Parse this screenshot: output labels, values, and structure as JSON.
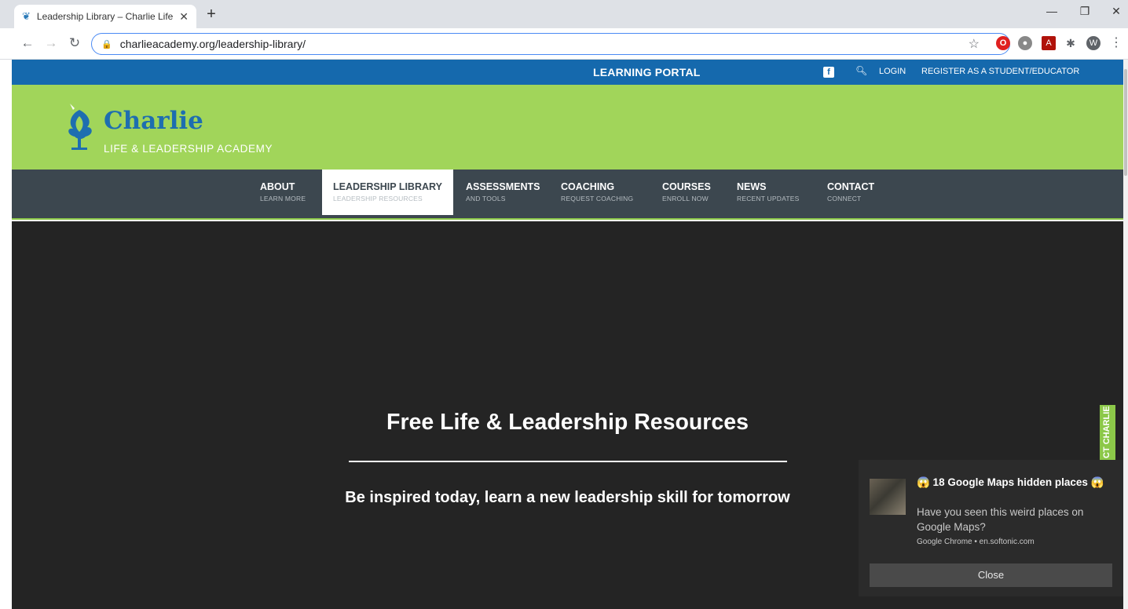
{
  "browser": {
    "tab_title": "Leadership Library – Charlie Life /",
    "tab_close": "✕",
    "new_tab": "+",
    "url": "charlieacademy.org/leadership-library/",
    "profile_initial": "W"
  },
  "site": {
    "topbar": {
      "portal": "LEARNING PORTAL",
      "facebook_glyph": "f",
      "login": "LOGIN",
      "register": "REGISTER AS A STUDENT/EDUCATOR"
    },
    "logo": {
      "name": "Charlie",
      "tagline": "LIFE & LEADERSHIP ACADEMY"
    },
    "nav": [
      {
        "title": "ABOUT",
        "sub": "LEARN MORE"
      },
      {
        "title": "LEADERSHIP LIBRARY",
        "sub": "LEADERSHIP RESOURCES"
      },
      {
        "title": "ASSESSMENTS",
        "sub": "AND TOOLS"
      },
      {
        "title": "COACHING",
        "sub": "REQUEST COACHING"
      },
      {
        "title": "COURSES",
        "sub": "ENROLL NOW"
      },
      {
        "title": "NEWS",
        "sub": "RECENT UPDATES"
      },
      {
        "title": "CONTACT",
        "sub": "CONNECT"
      }
    ],
    "hero": {
      "title": "Free Life & Leadership Resources",
      "subtitle": "Be inspired today, learn a new leadership skill for tomorrow"
    },
    "side_tab": "CT CHARLIE"
  },
  "notification": {
    "title": "😱 18 Google Maps hidden places 😱",
    "body": "Have you seen this weird places on Google Maps?",
    "source": "Google Chrome • en.softonic.com",
    "close": "Close"
  },
  "colors": {
    "topbar": "#1569ad",
    "header": "#a1d55a",
    "nav": "#3c474f",
    "hero": "#242424",
    "accent_green": "#8cc849"
  }
}
